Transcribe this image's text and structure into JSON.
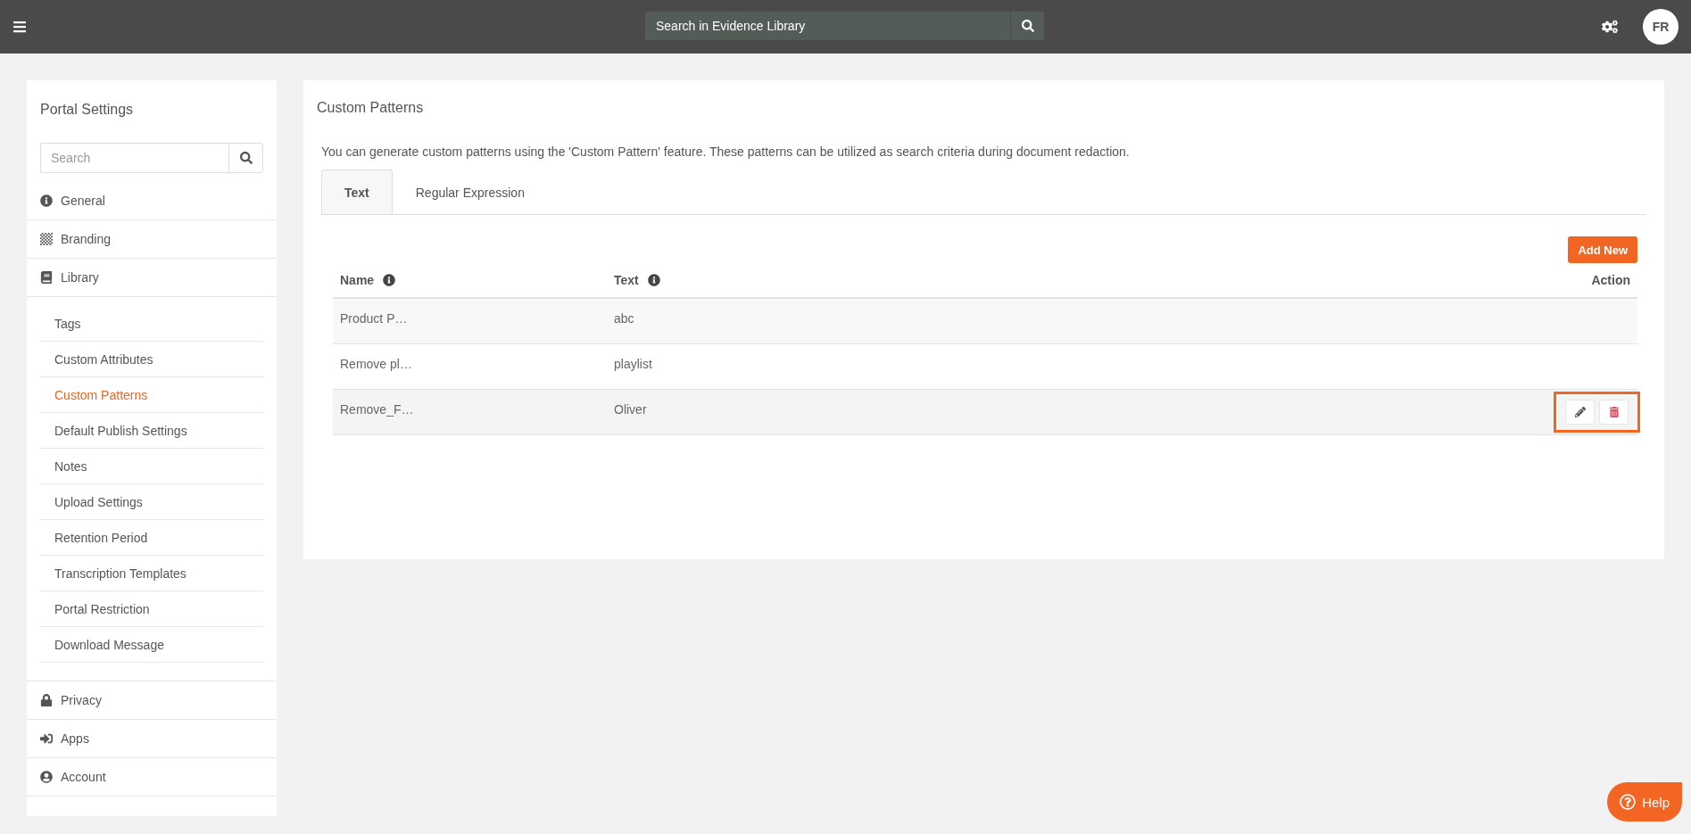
{
  "topbar": {
    "search": {
      "placeholder": "Search in Evidence Library"
    },
    "avatar": "FR"
  },
  "sidebar": {
    "title": "Portal Settings",
    "search": {
      "placeholder": "Search"
    },
    "items": [
      {
        "label": "General"
      },
      {
        "label": "Branding"
      },
      {
        "label": "Library",
        "children": [
          {
            "label": "Tags",
            "selected": false
          },
          {
            "label": "Custom Attributes",
            "selected": false
          },
          {
            "label": "Custom Patterns",
            "selected": true
          },
          {
            "label": "Default Publish Settings",
            "selected": false
          },
          {
            "label": "Notes",
            "selected": false
          },
          {
            "label": "Upload Settings",
            "selected": false
          },
          {
            "label": "Retention Period",
            "selected": false
          },
          {
            "label": "Transcription Templates",
            "selected": false
          },
          {
            "label": "Portal Restriction",
            "selected": false
          },
          {
            "label": "Download Message",
            "selected": false
          }
        ]
      },
      {
        "label": "Privacy"
      },
      {
        "label": "Apps"
      },
      {
        "label": "Account"
      }
    ]
  },
  "main": {
    "title": "Custom Patterns",
    "description": "You can generate custom patterns using the 'Custom Pattern' feature. These patterns can be utilized as search criteria during document redaction.",
    "tabs": [
      {
        "label": "Text",
        "selected": true
      },
      {
        "label": "Regular Expression",
        "selected": false
      }
    ],
    "add_button": "Add New",
    "table": {
      "columns": [
        "Name",
        "Text",
        "Action"
      ],
      "rows": [
        {
          "name": "Product P…",
          "text": "abc",
          "hovered": false
        },
        {
          "name": "Remove pl…",
          "text": "playlist",
          "hovered": false
        },
        {
          "name": "Remove_F…",
          "text": "Oliver",
          "hovered": true
        }
      ]
    }
  },
  "help_button": "Help"
}
